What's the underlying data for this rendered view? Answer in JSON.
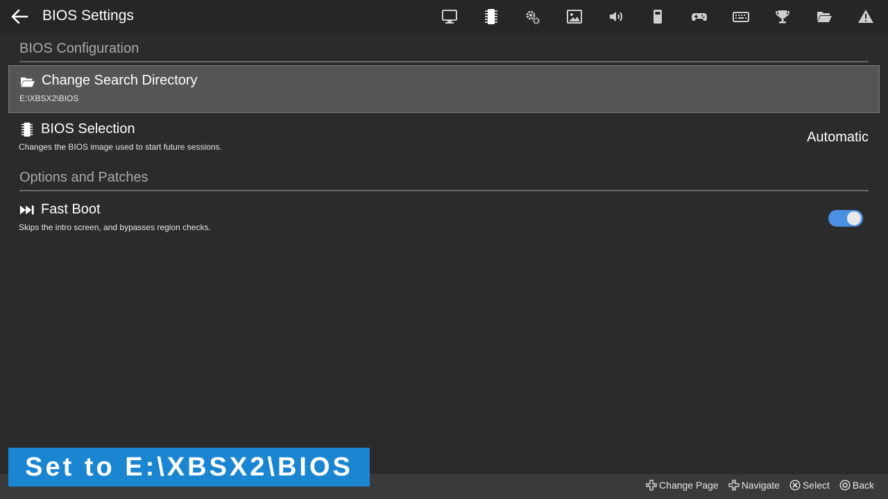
{
  "header": {
    "title": "BIOS Settings",
    "nav_icons": [
      "monitor-icon",
      "chip-icon",
      "gears-icon",
      "image-icon",
      "volume-icon",
      "memory-card-icon",
      "gamepad-icon",
      "keyboard-icon",
      "trophy-icon",
      "folder-icon",
      "warning-icon"
    ],
    "active_icon": "chip-icon"
  },
  "sections": {
    "bios_configuration": {
      "title": "BIOS Configuration",
      "items": {
        "search_directory": {
          "title": "Change Search Directory",
          "description": "E:\\XBSX2\\BIOS",
          "icon": "folder-open-icon"
        },
        "bios_selection": {
          "title": "BIOS Selection",
          "description": "Changes the BIOS image used to start future sessions.",
          "value": "Automatic",
          "icon": "chip-icon"
        }
      }
    },
    "options_patches": {
      "title": "Options and Patches",
      "items": {
        "fast_boot": {
          "title": "Fast Boot",
          "description": "Skips the intro screen, and bypasses region checks.",
          "enabled": true,
          "icon": "fast-forward-icon"
        }
      }
    }
  },
  "footer": {
    "hints": {
      "change_page": "Change Page",
      "navigate": "Navigate",
      "select": "Select",
      "back": "Back"
    }
  },
  "caption": "Set to E:\\XBSX2\\BIOS",
  "colors": {
    "accent": "#4a90e2",
    "caption_bg": "#1a86d1",
    "selected_row": "#555555",
    "background": "#2b2b2b"
  }
}
